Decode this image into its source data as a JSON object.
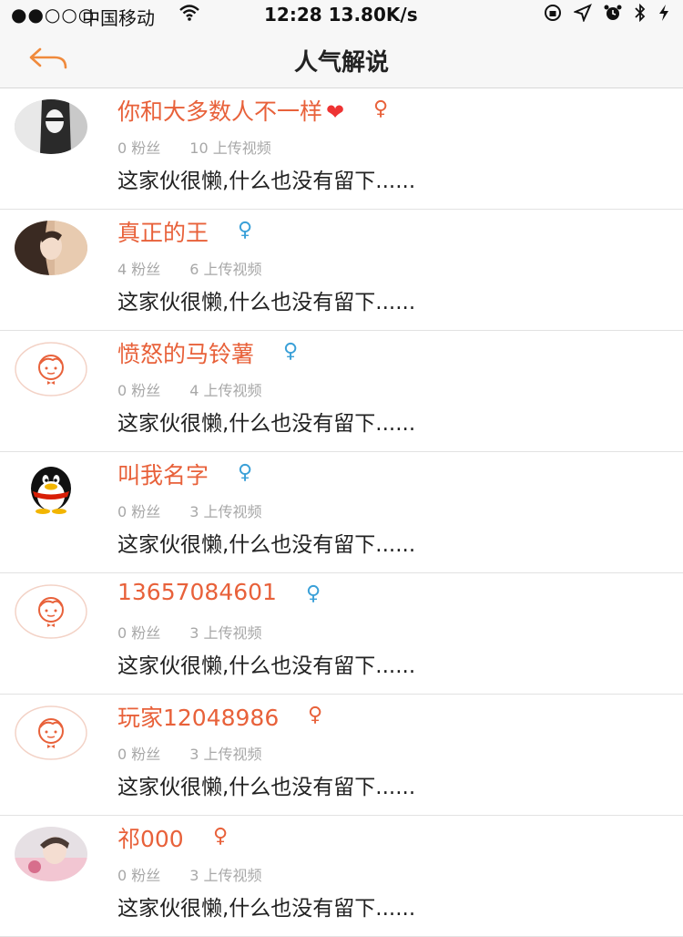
{
  "status_bar": {
    "signal": "●●○○○",
    "carrier": "中国移动",
    "wifi_icon": "wifi-icon",
    "time_speed": "12:28 13.80K/s",
    "right_icons": [
      "rotation-lock-icon",
      "location-icon",
      "alarm-icon",
      "bluetooth-icon",
      "charging-icon"
    ]
  },
  "nav": {
    "back_icon": "back-arrow-icon",
    "title": "人气解说"
  },
  "colors": {
    "accent": "#e8613a",
    "female_orange": "#e8613a",
    "female_blue": "#3aa0d8"
  },
  "users": [
    {
      "name": "你和大多数人不一样",
      "heart": "❤",
      "gender": "♀",
      "gender_color": "orange",
      "fans": "0 粉丝",
      "videos": "10 上传视频",
      "bio": "这家伙很懒,什么也没有留下......",
      "avatar": "photo-dark"
    },
    {
      "name": "真正的王",
      "heart": "",
      "gender": "♀",
      "gender_color": "blue",
      "fans": "4 粉丝",
      "videos": "6 上传视频",
      "bio": "这家伙很懒,什么也没有留下......",
      "avatar": "photo-girl"
    },
    {
      "name": "愤怒的马铃薯",
      "heart": "",
      "gender": "♀",
      "gender_color": "blue",
      "fans": "0 粉丝",
      "videos": "4 上传视频",
      "bio": "这家伙很懒,什么也没有留下......",
      "avatar": "default"
    },
    {
      "name": "叫我名字",
      "heart": "",
      "gender": "♀",
      "gender_color": "blue",
      "fans": "0 粉丝",
      "videos": "3 上传视频",
      "bio": "这家伙很懒,什么也没有留下......",
      "avatar": "penguin"
    },
    {
      "name": "13657084601",
      "heart": "",
      "gender": "♀",
      "gender_color": "blue",
      "fans": "0 粉丝",
      "videos": "3 上传视频",
      "bio": "这家伙很懒,什么也没有留下......",
      "avatar": "default"
    },
    {
      "name": "玩家12048986",
      "heart": "",
      "gender": "♀",
      "gender_color": "orange",
      "fans": "0 粉丝",
      "videos": "3 上传视频",
      "bio": "这家伙很懒,什么也没有留下......",
      "avatar": "default"
    },
    {
      "name": "祁000",
      "heart": "",
      "gender": "♀",
      "gender_color": "orange",
      "fans": "0 粉丝",
      "videos": "3 上传视频",
      "bio": "这家伙很懒,什么也没有留下......",
      "avatar": "photo-child"
    }
  ]
}
